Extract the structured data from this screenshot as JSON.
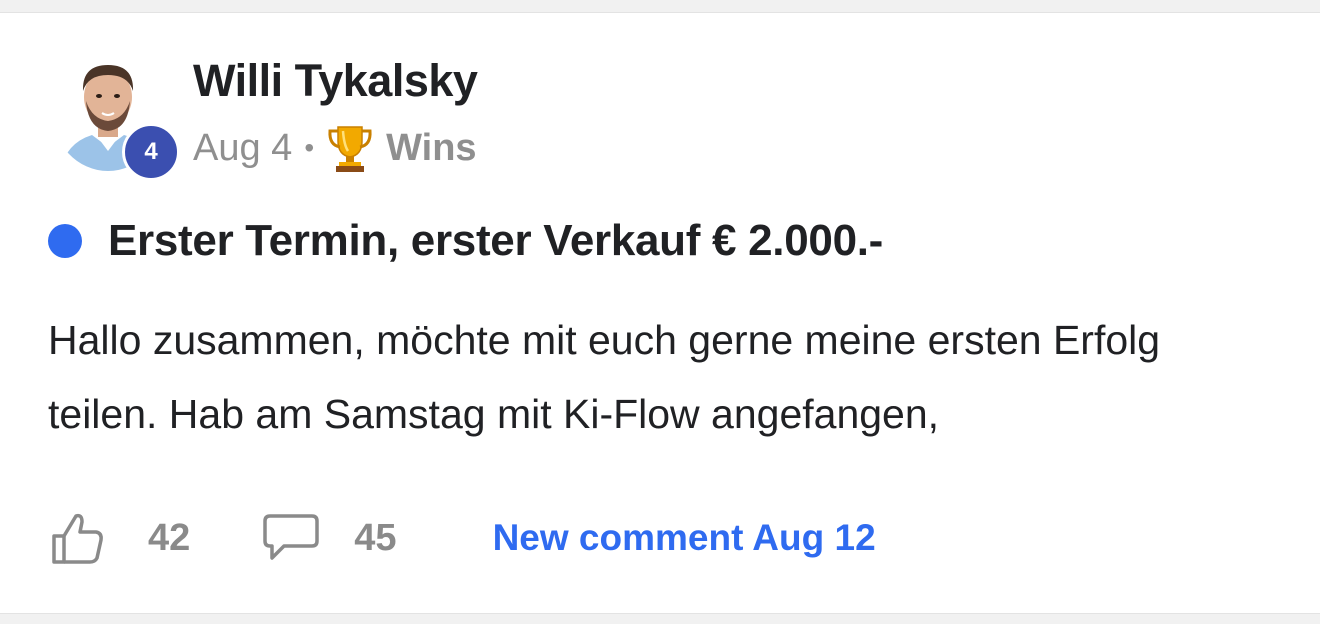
{
  "post": {
    "author": {
      "name": "Willi Tykalsky",
      "level": "4"
    },
    "date": "Aug 4",
    "separator": "•",
    "category": {
      "icon": "trophy-icon",
      "label": "Wins"
    },
    "unread": true,
    "unread_color": "#2f6bf0",
    "title": "Erster Termin, erster Verkauf € 2.000.-",
    "body": "Hallo zusammen, möchte mit euch gerne meine ersten Erfolg teilen. Hab am Samstag mit Ki-Flow angefangen,",
    "likes": "42",
    "comments": "45",
    "new_comment_label": "New comment Aug 12"
  },
  "colors": {
    "accent": "#2f6bf0",
    "level_badge": "#3b4fb0",
    "text": "#202124",
    "muted": "#8f8f8f"
  }
}
